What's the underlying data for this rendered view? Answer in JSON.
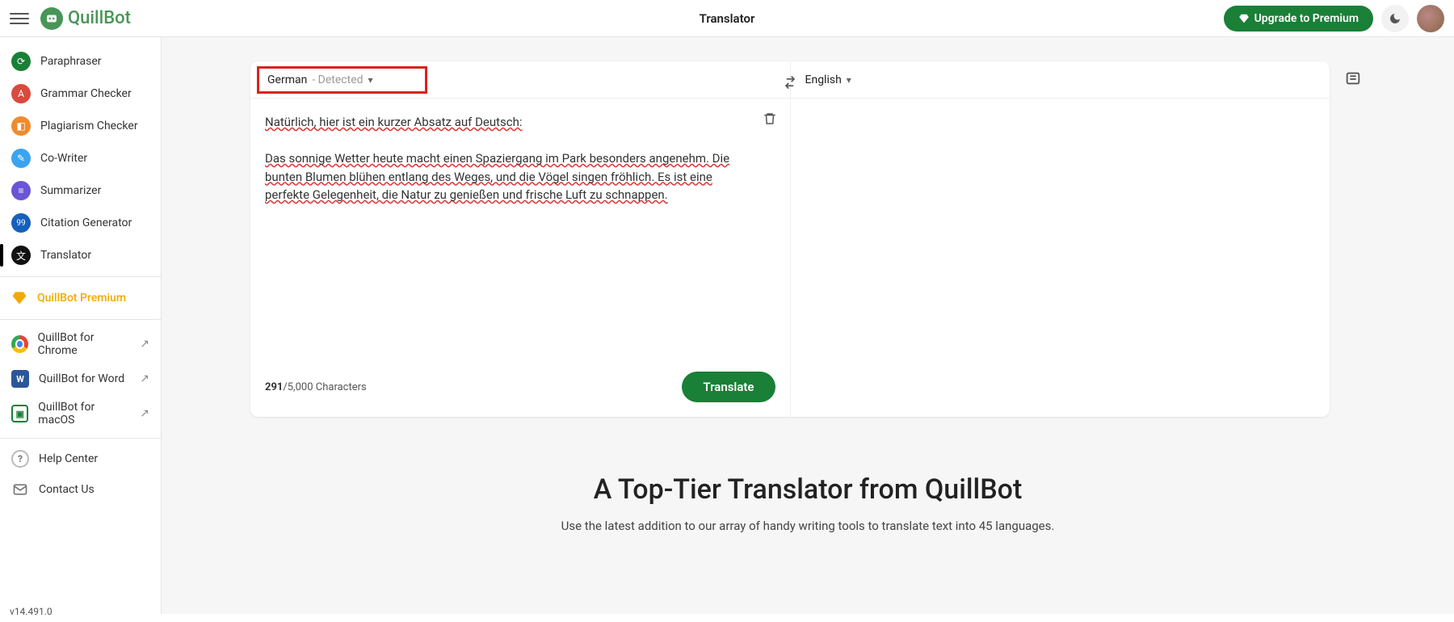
{
  "header": {
    "brand": "QuillBot",
    "page_title": "Translator",
    "premium_button": "Upgrade to Premium"
  },
  "sidebar": {
    "items": [
      {
        "label": "Paraphraser",
        "icon_bg": "#1a7f37",
        "glyph": "⟳"
      },
      {
        "label": "Grammar Checker",
        "icon_bg": "#d94a3d",
        "glyph": "A"
      },
      {
        "label": "Plagiarism Checker",
        "icon_bg": "#f08b2e",
        "glyph": "◧"
      },
      {
        "label": "Co-Writer",
        "icon_bg": "#3aa4f0",
        "glyph": "✎"
      },
      {
        "label": "Summarizer",
        "icon_bg": "#6a54d8",
        "glyph": "≡"
      },
      {
        "label": "Citation Generator",
        "icon_bg": "#1560bd",
        "glyph": "99"
      },
      {
        "label": "Translator",
        "icon_bg": "#111111",
        "glyph": "文"
      }
    ],
    "premium_link": "QuillBot Premium",
    "extensions": [
      {
        "label": "QuillBot for Chrome",
        "icon_bg": "#fff",
        "glyph": "◐"
      },
      {
        "label": "QuillBot for Word",
        "icon_bg": "#2b579a",
        "glyph": "W"
      },
      {
        "label": "QuillBot for macOS",
        "icon_bg": "#1a7f37",
        "glyph": "▣"
      }
    ],
    "help": [
      {
        "label": "Help Center"
      },
      {
        "label": "Contact Us"
      }
    ]
  },
  "translator": {
    "source_lang": "German",
    "source_detected_suffix": " - Detected",
    "target_lang": "English",
    "input_line1": "Natürlich, hier ist ein kurzer Absatz auf Deutsch:",
    "input_para": "Das sonnige Wetter heute macht einen Spaziergang im Park besonders angenehm. Die bunten Blumen blühen entlang des Weges, und die Vögel singen fröhlich. Es ist eine perfekte Gelegenheit, die Natur zu genießen und frische Luft zu schnappen.",
    "char_current": "291",
    "char_max": "/5,000 Characters",
    "translate_button": "Translate"
  },
  "promo": {
    "heading": "A Top-Tier Translator from QuillBot",
    "sub": "Use the latest addition to our array of handy writing tools to translate text into 45 languages."
  },
  "version": "v14.491.0"
}
